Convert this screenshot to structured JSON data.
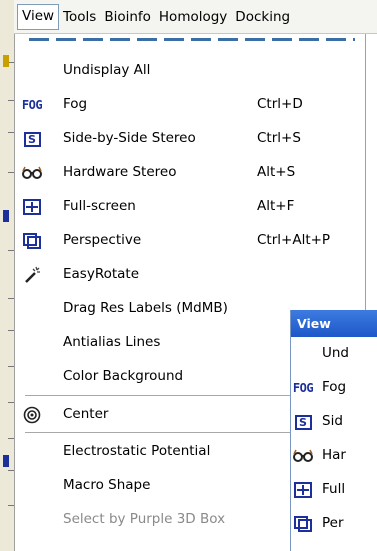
{
  "menubar": {
    "items": [
      "View",
      "Tools",
      "Bioinfo",
      "Homology",
      "Docking"
    ]
  },
  "menu": {
    "items": [
      {
        "label": "Undisplay All",
        "accel": "",
        "icon": "none",
        "disabled": false
      },
      {
        "label": "Fog",
        "accel": "Ctrl+D",
        "icon": "fog-icon",
        "disabled": false
      },
      {
        "label": "Side-by-Side Stereo",
        "accel": "Ctrl+S",
        "icon": "side-by-side-stereo-icon",
        "disabled": false
      },
      {
        "label": "Hardware Stereo",
        "accel": "Alt+S",
        "icon": "glasses-icon",
        "disabled": false
      },
      {
        "label": "Full-screen",
        "accel": "Alt+F",
        "icon": "fullscreen-icon",
        "disabled": false
      },
      {
        "label": "Perspective",
        "accel": "Ctrl+Alt+P",
        "icon": "perspective-icon",
        "disabled": false
      },
      {
        "label": "EasyRotate",
        "accel": "",
        "icon": "magic-wand-icon",
        "disabled": false
      },
      {
        "label": "Drag Res Labels (MdMB)",
        "accel": "",
        "icon": "none",
        "disabled": false
      },
      {
        "label": "Antialias Lines",
        "accel": "",
        "icon": "none",
        "disabled": false
      },
      {
        "label": "Color Background",
        "accel": "",
        "icon": "none",
        "disabled": false
      },
      {
        "label": "Center",
        "accel": "",
        "icon": "center-target-icon",
        "disabled": false
      },
      {
        "label": "Electrostatic Potential",
        "accel": "",
        "icon": "none",
        "disabled": false
      },
      {
        "label": "Macro Shape",
        "accel": "",
        "icon": "none",
        "disabled": false
      },
      {
        "label": "Select by Purple 3D Box",
        "accel": "",
        "icon": "none",
        "disabled": true
      }
    ]
  },
  "second_window": {
    "title": "View",
    "rows": [
      {
        "label": "Und",
        "icon": "none"
      },
      {
        "label": "Fog",
        "icon": "fog-icon"
      },
      {
        "label": "Sid",
        "icon": "side-by-side-stereo-icon"
      },
      {
        "label": "Har",
        "icon": "glasses-icon"
      },
      {
        "label": "Full",
        "icon": "fullscreen-icon"
      },
      {
        "label": "Per",
        "icon": "perspective-icon"
      }
    ]
  },
  "icon_glyphs": {
    "fog": "FOG",
    "stereo": "S"
  },
  "colors": {
    "icon_blue": "#1d2f9a",
    "titlebar": "#2a62d2",
    "disabled_text": "#8a8a8a"
  }
}
